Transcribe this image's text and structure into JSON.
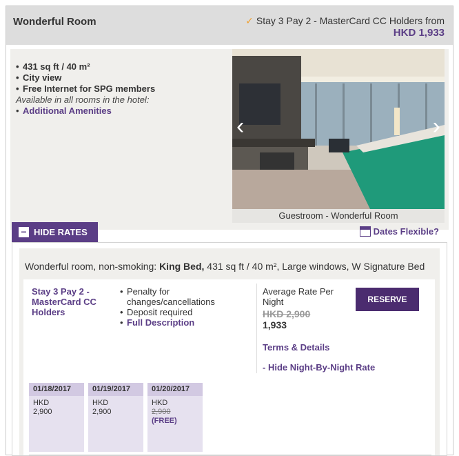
{
  "room": {
    "title": "Wonderful Room",
    "promo_text": "Stay 3 Pay 2 - MasterCard CC Holders from",
    "promo_price": "HKD 1,933",
    "features": [
      "431 sq ft / 40 m²",
      "City view",
      "Free Internet for SPG members"
    ],
    "available_note": "Available in all rooms in the hotel:",
    "amenities_link": "Additional Amenities",
    "photo_caption": "Guestroom - Wonderful Room",
    "prev_arrow": "‹",
    "next_arrow": "›"
  },
  "controls": {
    "hide_rates": "HIDE RATES",
    "hide_rates_sign": "−",
    "dates_flexible": "Dates Flexible?"
  },
  "rate": {
    "room_desc_prefix": "Wonderful room, non-smoking:",
    "room_desc_bed": "King Bed,",
    "room_desc_suffix": "431 sq ft / 40 m², Large windows, W Signature Bed",
    "name": "Stay 3 Pay 2 - MasterCard CC Holders",
    "terms": [
      "Penalty for changes/cancellations",
      "Deposit required"
    ],
    "full_description": "Full Description",
    "avg_label": "Average Rate Per Night",
    "old_price": "HKD 2,900",
    "new_price": "1,933",
    "reserve": "RESERVE",
    "terms_details": "Terms & Details",
    "hide_night": "- Hide Night-By-Night Rate"
  },
  "nights": [
    {
      "date": "01/18/2017",
      "currency": "HKD",
      "amount": "2,900"
    },
    {
      "date": "01/19/2017",
      "currency": "HKD",
      "amount": "2,900"
    },
    {
      "date": "01/20/2017",
      "currency": "HKD",
      "amount": "2,900",
      "free": "(FREE)"
    }
  ],
  "colors": {
    "brand_purple": "#5b3e86",
    "check_orange": "#f0a030"
  },
  "icons": [
    "check-icon",
    "chevron-left-icon",
    "chevron-right-icon",
    "minus-icon",
    "calendar-icon"
  ]
}
